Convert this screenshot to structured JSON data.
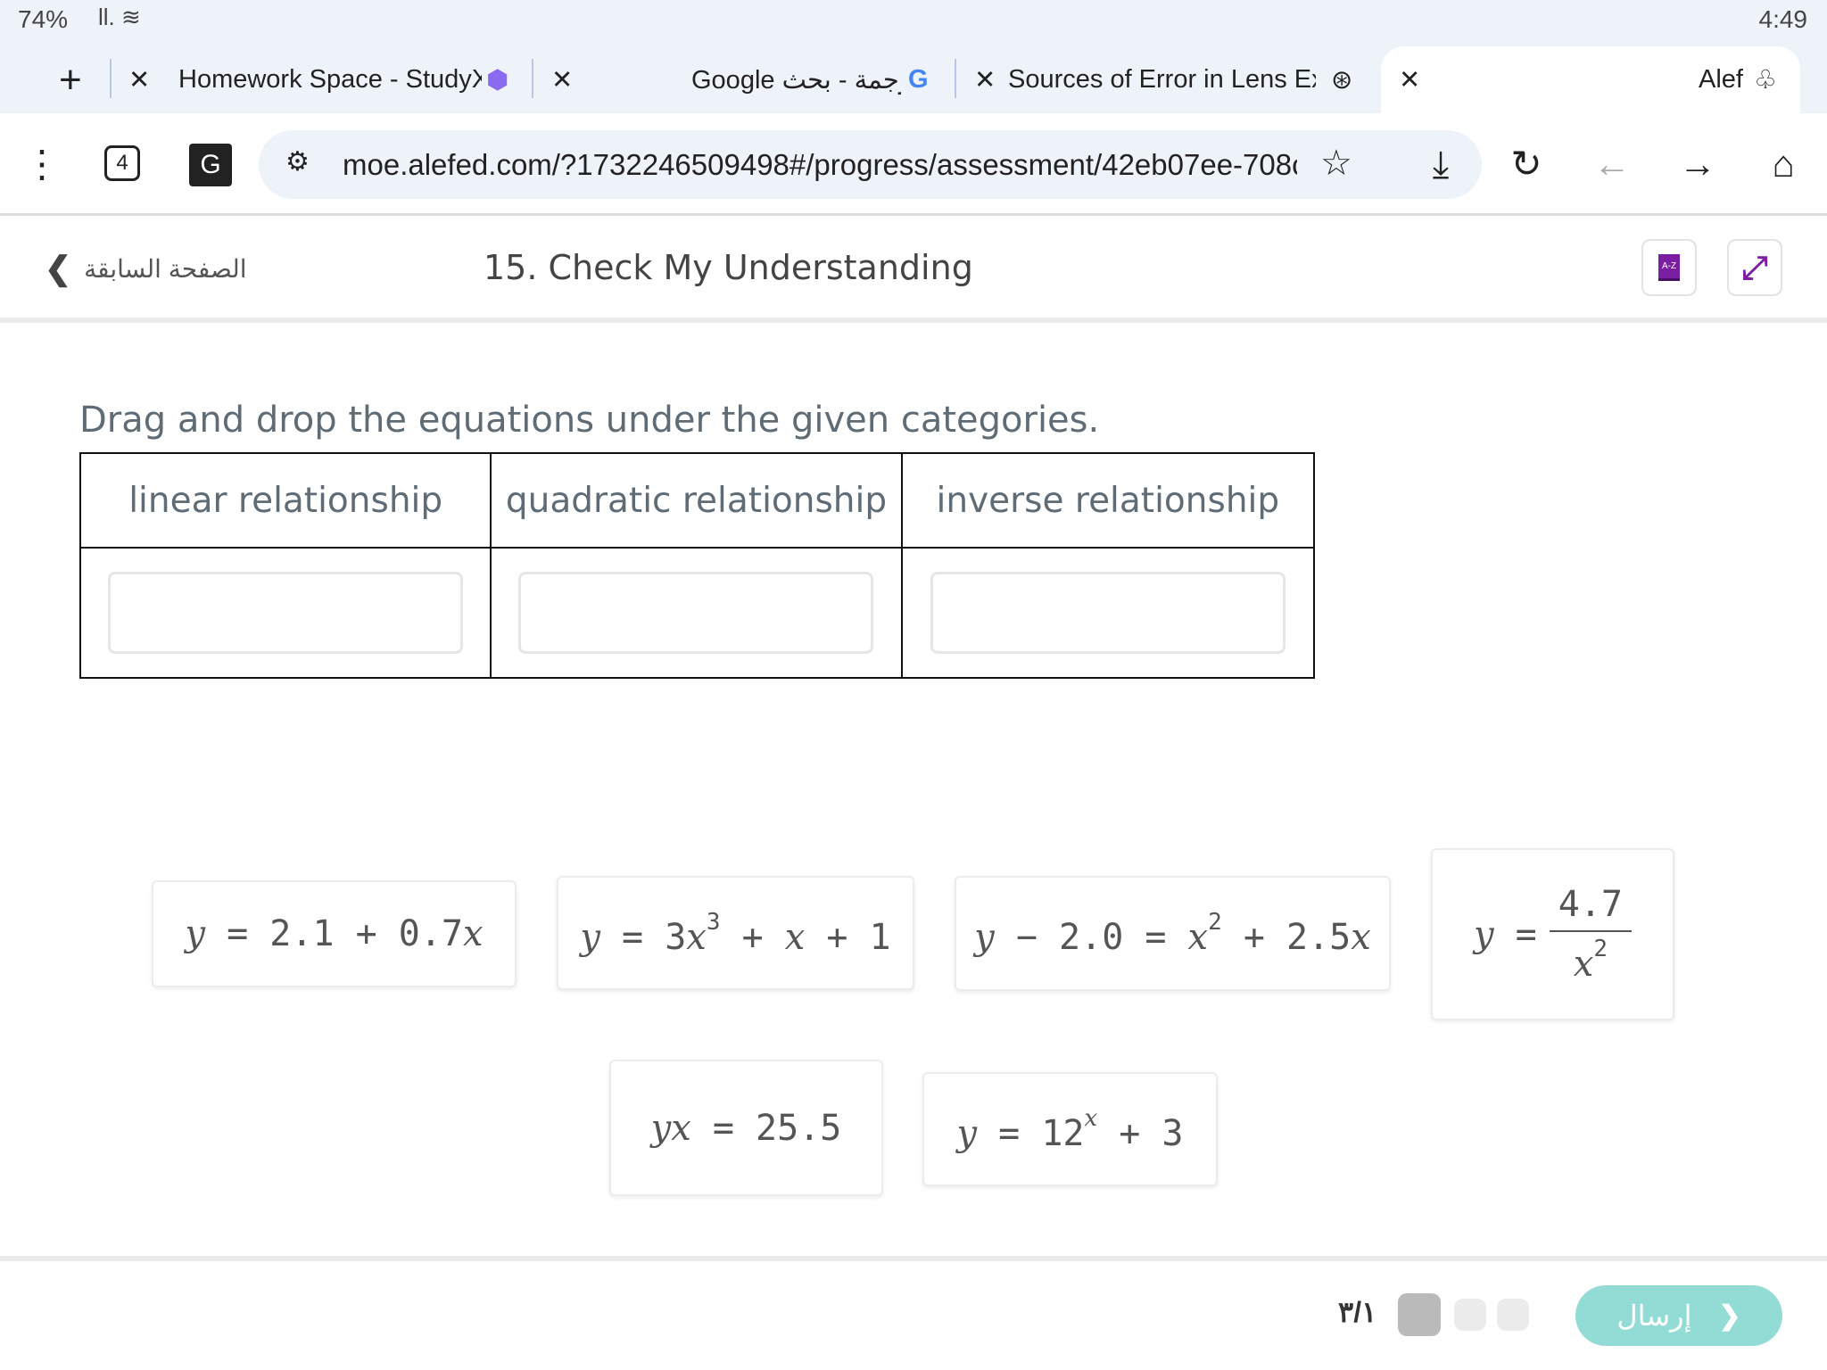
{
  "status": {
    "battery": "74%",
    "time": "4:49"
  },
  "tabs": [
    {
      "label": "Homework Space - StudyX"
    },
    {
      "label": "Google ترجمة - بحث"
    },
    {
      "label": "Sources of Error in Lens Exp"
    },
    {
      "label": "Alef"
    }
  ],
  "toolbar": {
    "tab_count": "4",
    "url": "moe.alefed.com/?1732246509498#/progress/assessment/42eb07ee-708c"
  },
  "header": {
    "back_label": "الصفحة السابقة",
    "title": "15. Check My Understanding",
    "dictionary_label": "A-Z"
  },
  "instruction": "Drag and drop the equations under the given categories.",
  "categories": [
    "linear relationship",
    "quadratic relationship",
    "inverse relationship"
  ],
  "equations": [
    {
      "text": "y = 2.1 + 0.7x"
    },
    {
      "text": "y = 3x^3 + x + 1"
    },
    {
      "text": "y − 2.0 = x^2 + 2.5x"
    },
    {
      "text": "y = 4.7 / x^2",
      "num": "4.7",
      "den": "x",
      "den_exp": "2"
    },
    {
      "text": "yx = 25.5"
    },
    {
      "text": "y = 12^x + 3"
    }
  ],
  "footer": {
    "pager": "٣/١",
    "current_page": 1,
    "total_pages": 3,
    "submit_label": "إرسال"
  },
  "colors": {
    "accent": "#93dcd5",
    "brand": "#7b1fa2"
  }
}
